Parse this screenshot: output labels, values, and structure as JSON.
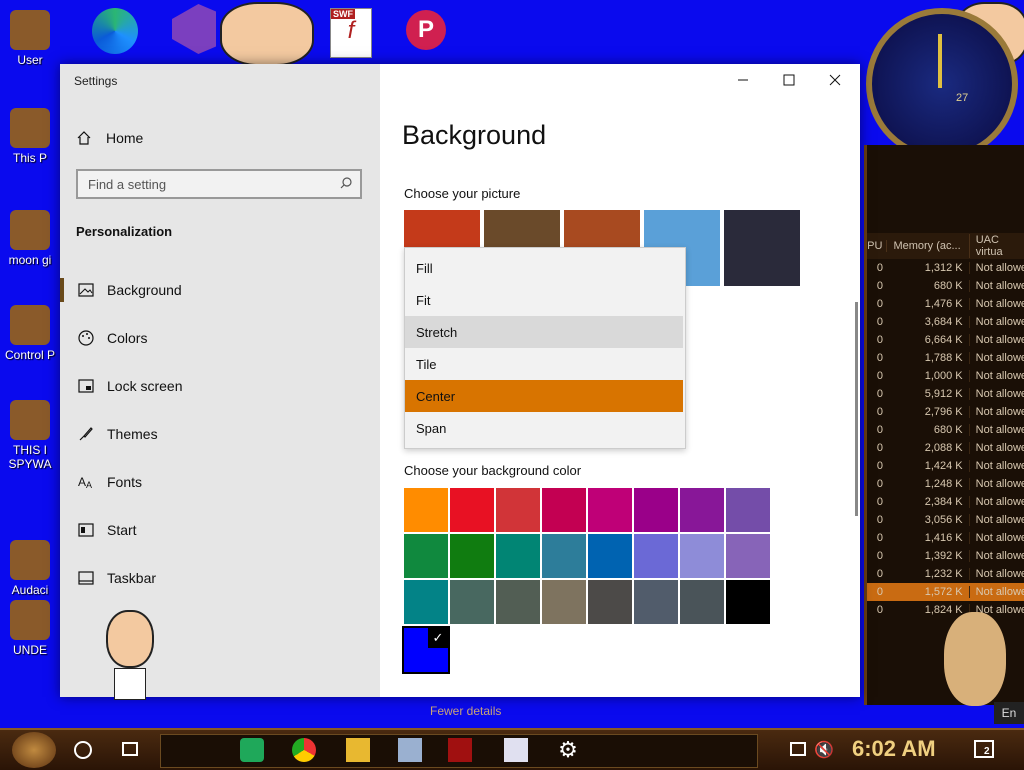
{
  "desktop": {
    "icons": [
      {
        "label": "User"
      },
      {
        "label": "This P"
      },
      {
        "label": "moon gi"
      },
      {
        "label": "Control P"
      },
      {
        "label": "THIS I\nSPYWA"
      },
      {
        "label": "Audaci"
      },
      {
        "label": "UNDE"
      }
    ],
    "top_icons": [
      {
        "name": "edge-icon"
      },
      {
        "name": "visual-studio-icon"
      },
      {
        "name": "flash-swf-icon",
        "badge": "SWF"
      },
      {
        "name": "pdf-editor-icon"
      }
    ],
    "clock_widget": {
      "number": "27"
    }
  },
  "task_manager": {
    "headers": [
      "PU",
      "Memory (ac...",
      "UAC virtua"
    ],
    "rows": [
      {
        "cpu": "0",
        "mem": "1,312 K",
        "uac": "Not allowe"
      },
      {
        "cpu": "0",
        "mem": "680 K",
        "uac": "Not allowe"
      },
      {
        "cpu": "0",
        "mem": "1,476 K",
        "uac": "Not allowe"
      },
      {
        "cpu": "0",
        "mem": "3,684 K",
        "uac": "Not allowe"
      },
      {
        "cpu": "0",
        "mem": "6,664 K",
        "uac": "Not allowe"
      },
      {
        "cpu": "0",
        "mem": "1,788 K",
        "uac": "Not allowe"
      },
      {
        "cpu": "0",
        "mem": "1,000 K",
        "uac": "Not allowe"
      },
      {
        "cpu": "0",
        "mem": "5,912 K",
        "uac": "Not allowe"
      },
      {
        "cpu": "0",
        "mem": "2,796 K",
        "uac": "Not allowe"
      },
      {
        "cpu": "0",
        "mem": "680 K",
        "uac": "Not allowe"
      },
      {
        "cpu": "0",
        "mem": "2,088 K",
        "uac": "Not allowe"
      },
      {
        "cpu": "0",
        "mem": "1,424 K",
        "uac": "Not allowe"
      },
      {
        "cpu": "0",
        "mem": "1,248 K",
        "uac": "Not allowe"
      },
      {
        "cpu": "0",
        "mem": "2,384 K",
        "uac": "Not allowe"
      },
      {
        "cpu": "0",
        "mem": "3,056 K",
        "uac": "Not allowe"
      },
      {
        "cpu": "0",
        "mem": "1,416 K",
        "uac": "Not allowe"
      },
      {
        "cpu": "0",
        "mem": "1,392 K",
        "uac": "Not allowe"
      },
      {
        "cpu": "0",
        "mem": "1,232 K",
        "uac": "Not allowe"
      },
      {
        "cpu": "0",
        "mem": "1,572 K",
        "uac": "Not allowe",
        "selected": true
      },
      {
        "cpu": "0",
        "mem": "1,824 K",
        "uac": "Not allowe"
      }
    ],
    "fewer_details": "Fewer details"
  },
  "settings": {
    "window_title": "Settings",
    "home_label": "Home",
    "search_placeholder": "Find a setting",
    "section_title": "Personalization",
    "nav_items": [
      {
        "label": "Background",
        "icon": "picture-icon",
        "active": true
      },
      {
        "label": "Colors",
        "icon": "palette-icon"
      },
      {
        "label": "Lock screen",
        "icon": "lock-screen-icon"
      },
      {
        "label": "Themes",
        "icon": "brush-icon"
      },
      {
        "label": "Fonts",
        "icon": "fonts-icon"
      },
      {
        "label": "Start",
        "icon": "start-icon"
      },
      {
        "label": "Taskbar",
        "icon": "taskbar-icon"
      }
    ],
    "page_title": "Background",
    "choose_picture_label": "Choose your picture",
    "picture_thumbs": [
      {
        "name": "thumb-cartoon",
        "color": "#c43a1a"
      },
      {
        "name": "thumb-steampunk",
        "color": "#6a4a2a"
      },
      {
        "name": "thumb-eye",
        "color": "#a84a20"
      },
      {
        "name": "thumb-beach",
        "color": "#5aa0d8"
      },
      {
        "name": "thumb-night-sky",
        "color": "#2a2a3a"
      }
    ],
    "fit_options": [
      {
        "label": "Fill"
      },
      {
        "label": "Fit"
      },
      {
        "label": "Stretch",
        "hover": true
      },
      {
        "label": "Tile"
      },
      {
        "label": "Center",
        "selected": true
      },
      {
        "label": "Span"
      }
    ],
    "bg_color_label": "Choose your background color",
    "colors": [
      "#ff8c00",
      "#e81123",
      "#d13438",
      "#c30052",
      "#bf0077",
      "#9a0089",
      "#881798",
      "#744da9",
      "#10893e",
      "#107c10",
      "#018574",
      "#2d7d9a",
      "#0063b1",
      "#6b69d6",
      "#8e8cd8",
      "#8764b8",
      "#038387",
      "#486860",
      "#525e54",
      "#7e735f",
      "#4c4a48",
      "#515c6b",
      "#4a5459",
      "#000000"
    ],
    "custom_color": "#0000ff",
    "check_glyph": "✓"
  },
  "taskbar": {
    "time": "6:02 AM",
    "notification_count": "2",
    "enter_label": "En"
  }
}
